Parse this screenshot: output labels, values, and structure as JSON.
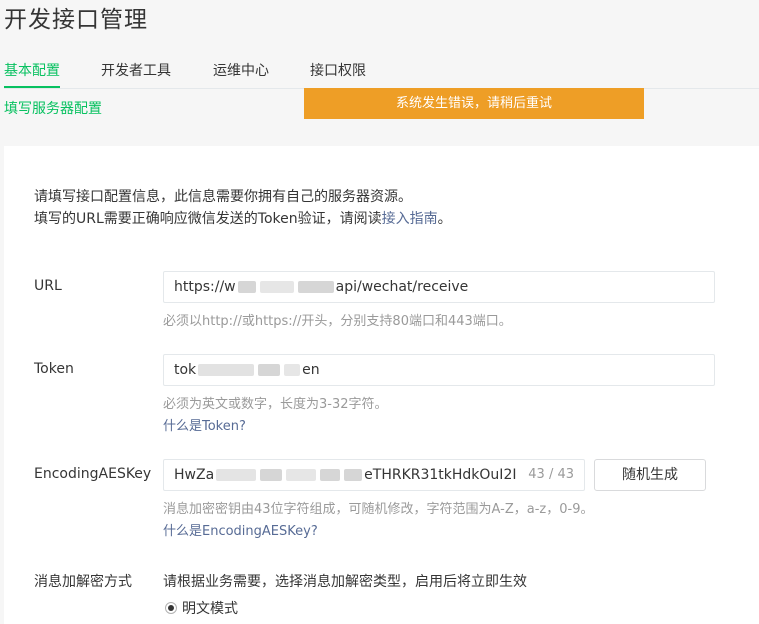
{
  "page": {
    "title": "开发接口管理"
  },
  "tabs": [
    {
      "label": "基本配置",
      "active": true
    },
    {
      "label": "开发者工具",
      "active": false
    },
    {
      "label": "运维中心",
      "active": false
    },
    {
      "label": "接口权限",
      "active": false
    }
  ],
  "section": {
    "title": "填写服务器配置"
  },
  "toast": {
    "message": "系统发生错误，请稍后重试",
    "color": "#ee9e26"
  },
  "intro": {
    "line1": "请填写接口配置信息，此信息需要你拥有自己的服务器资源。",
    "line2_prefix": "填写的URL需要正确响应微信发送的Token验证，请阅读",
    "line2_link": "接入指南",
    "line2_suffix": "。"
  },
  "form": {
    "url": {
      "label": "URL",
      "value_start": "https://w",
      "value_end": "api/wechat/receive",
      "hint": "必须以http://或https://开头，分别支持80端口和443端口。"
    },
    "token": {
      "label": "Token",
      "value_start": "tok",
      "value_end": "en",
      "hint": "必须为英文或数字，长度为3-32字符。",
      "help_link": "什么是Token?"
    },
    "aes_key": {
      "label": "EncodingAESKey",
      "value_start": "HwZa",
      "value_end": "eTHRKR31tkHdkOuI2I",
      "counter": "43 / 43",
      "generate_button": "随机生成",
      "hint": "消息加密密钥由43位字符组成，可随机修改，字符范围为A-Z，a-z，0-9。",
      "help_link": "什么是EncodingAESKey?"
    },
    "encryption_mode": {
      "label": "消息加解密方式",
      "description": "请根据业务需要，选择消息加解密类型，启用后将立即生效",
      "selected_option": "明文模式"
    }
  },
  "colors": {
    "accent": "#07c160",
    "link": "#576b95",
    "hint": "#9a9a9a"
  }
}
